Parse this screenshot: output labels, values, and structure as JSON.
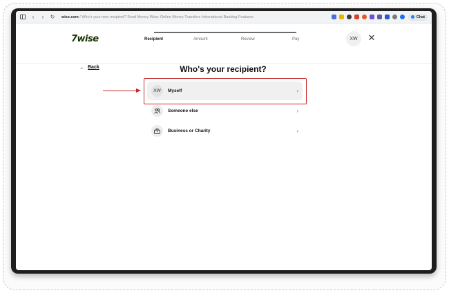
{
  "browser": {
    "url_domain": "wise.com",
    "url_rest": " / Who's your new recipient? Send Money Wise: Online Money Transfers International Banking Features",
    "chat_label": "Chat",
    "extension_colors": [
      "#4a6fd8",
      "#e8b400",
      "#3b3b3b",
      "#d6452a",
      "#e05a2b",
      "#6b4fd8",
      "#5c5c9c",
      "#2a56c6",
      "#7a7a7a",
      "#1f6feb"
    ]
  },
  "header": {
    "logo": "7wise",
    "steps": [
      {
        "label": "Recipient",
        "active": true
      },
      {
        "label": "Amount",
        "active": false
      },
      {
        "label": "Review",
        "active": false
      },
      {
        "label": "Pay",
        "active": false
      }
    ],
    "progress_fraction": 1.0,
    "avatar_initials": "XW",
    "close_glyph": "✕"
  },
  "main": {
    "back_arrow": "←",
    "back_label": "Back",
    "title": "Who's your recipient?",
    "options": [
      {
        "icon": "XW",
        "icon_name": "initials-avatar",
        "label": "Myself",
        "chevron": "›"
      },
      {
        "icon": "",
        "icon_name": "people-icon",
        "label": "Someone else",
        "chevron": "›"
      },
      {
        "icon": "",
        "icon_name": "briefcase-icon",
        "label": "Business or Charity",
        "chevron": "›"
      }
    ]
  },
  "accent_colors": {
    "highlight": "#c62828",
    "brand": "#163300"
  }
}
